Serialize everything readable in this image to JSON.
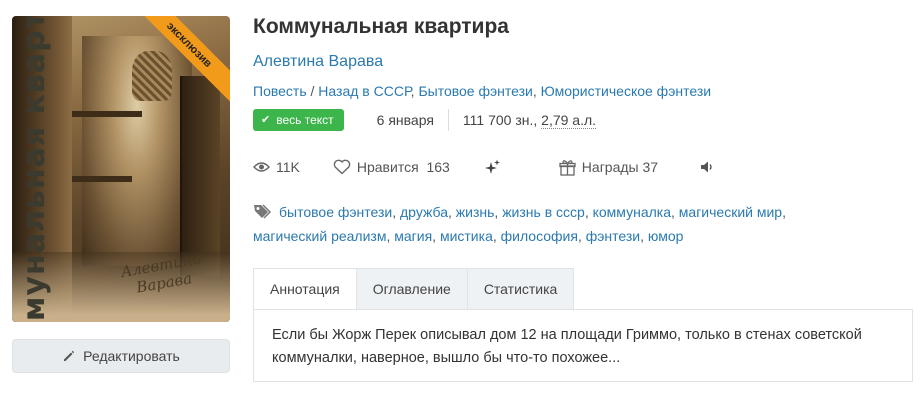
{
  "cover": {
    "vertical_title": "Коммунальная квартира",
    "author_line1": "Алевтина",
    "author_line2": "Варава",
    "ribbon": "эксклюзив"
  },
  "edit_button": {
    "label": "Редактировать",
    "icon": "pencil-icon"
  },
  "book": {
    "title": "Коммунальная квартира",
    "author": "Алевтина Варава",
    "genres": [
      "Повесть",
      "Назад в СССР",
      "Бытовое фэнтези",
      "Юмористическое фэнтези"
    ],
    "genre_separator": " / "
  },
  "meta": {
    "badge": "весь текст",
    "date": "6 января",
    "size_chars": "111 700 зн.,",
    "size_al": "2,79 а.л."
  },
  "stats": {
    "views": "11K",
    "likes_label": "Нравится",
    "likes_count": "163",
    "awards_label": "Награды",
    "awards_count": "37"
  },
  "tags": [
    "бытовое фэнтези",
    "дружба",
    "жизнь",
    "жизнь в ссср",
    "коммуналка",
    "магический мир",
    "магический реализм",
    "магия",
    "мистика",
    "философия",
    "фэнтези",
    "юмор"
  ],
  "tabs": [
    "Аннотация",
    "Оглавление",
    "Статистика"
  ],
  "annotation": "Если бы Жорж Перек описывал дом 12 на площади Гриммо, только в стенах советской коммуналки, наверное, вышло бы что-то похожее...",
  "colors": {
    "link": "#2a7ab0",
    "badge": "#3cb54a",
    "ribbon": "#f29a1a"
  }
}
